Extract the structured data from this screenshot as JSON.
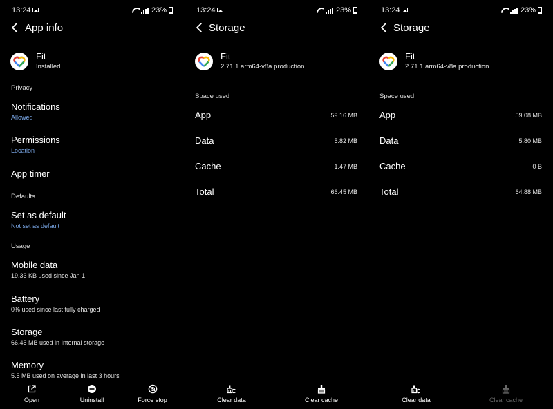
{
  "status": {
    "time": "13:24",
    "battery": "23%"
  },
  "app_info": {
    "title": "App info",
    "app_name": "Fit",
    "app_status": "Installed",
    "privacy_label": "Privacy",
    "notifications": {
      "title": "Notifications",
      "sub": "Allowed"
    },
    "permissions": {
      "title": "Permissions",
      "sub": "Location"
    },
    "app_timer": {
      "title": "App timer"
    },
    "defaults_label": "Defaults",
    "set_default": {
      "title": "Set as default",
      "sub": "Not set as default"
    },
    "usage_label": "Usage",
    "mobile_data": {
      "title": "Mobile data",
      "sub": "19.33 KB used since Jan 1"
    },
    "battery": {
      "title": "Battery",
      "sub": "0% used since last fully charged"
    },
    "storage": {
      "title": "Storage",
      "sub": "66.45 MB used in Internal storage"
    },
    "memory": {
      "title": "Memory",
      "sub": "5.5 MB used on average in last 3 hours"
    },
    "actions": {
      "open": "Open",
      "uninstall": "Uninstall",
      "force_stop": "Force stop"
    }
  },
  "storage_before": {
    "title": "Storage",
    "app_name": "Fit",
    "version": "2.71.1.arm64-v8a.production",
    "space_used_label": "Space used",
    "rows": [
      {
        "label": "App",
        "value": "59.16 MB"
      },
      {
        "label": "Data",
        "value": "5.82 MB"
      },
      {
        "label": "Cache",
        "value": "1.47 MB"
      },
      {
        "label": "Total",
        "value": "66.45 MB"
      }
    ],
    "actions": {
      "clear_data": "Clear data",
      "clear_cache": "Clear cache"
    }
  },
  "storage_after": {
    "title": "Storage",
    "app_name": "Fit",
    "version": "2.71.1.arm64-v8a.production",
    "space_used_label": "Space used",
    "rows": [
      {
        "label": "App",
        "value": "59.08 MB"
      },
      {
        "label": "Data",
        "value": "5.80 MB"
      },
      {
        "label": "Cache",
        "value": "0 B"
      },
      {
        "label": "Total",
        "value": "64.88 MB"
      }
    ],
    "actions": {
      "clear_data": "Clear data",
      "clear_cache": "Clear cache"
    },
    "clear_cache_enabled": false
  },
  "colors": {
    "background": "#000000",
    "link_blue": "#7aa7e6",
    "disabled": "#666666"
  },
  "icons": [
    "back-arrow-icon",
    "fit-heart-logo",
    "open-external-icon",
    "uninstall-minus-icon",
    "force-stop-icon",
    "clear-data-icon",
    "clear-cache-icon",
    "wifi-icon",
    "signal-icon",
    "battery-icon",
    "image-notification-icon"
  ]
}
